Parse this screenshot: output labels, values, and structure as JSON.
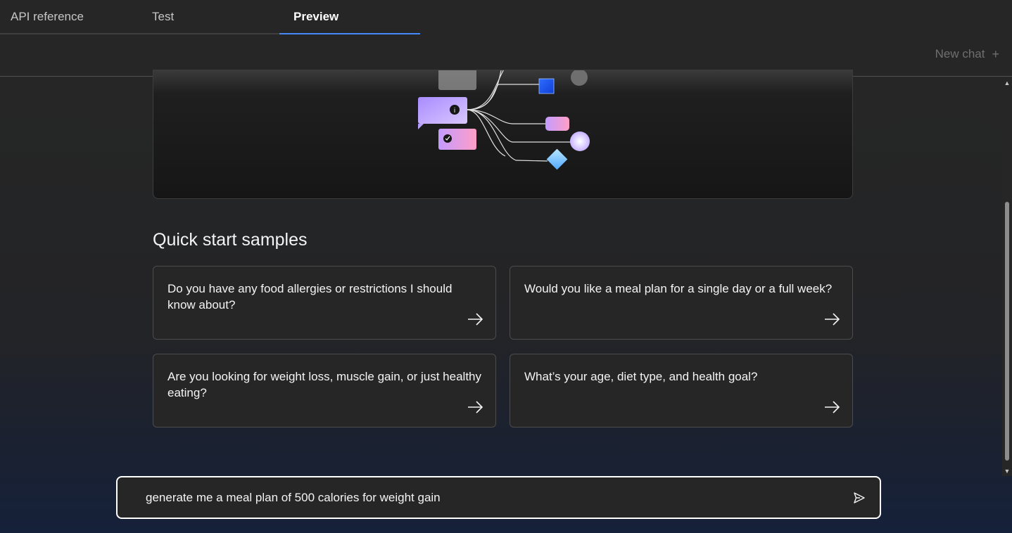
{
  "tabs": [
    {
      "label": "API reference",
      "active": false
    },
    {
      "label": "Test",
      "active": false
    },
    {
      "label": "Preview",
      "active": true
    }
  ],
  "toolbar": {
    "new_chat_label": "New chat",
    "new_chat_icon": "plus-icon"
  },
  "quick_start": {
    "title": "Quick start samples",
    "samples": [
      {
        "text": "Do you have any food allergies or restrictions I should know about?",
        "icon": "arrow-right-icon"
      },
      {
        "text": "Would you like a meal plan for a single day or a full week?",
        "icon": "arrow-right-icon"
      },
      {
        "text": "Are you looking for weight loss, muscle gain, or just healthy eating?",
        "icon": "arrow-right-icon"
      },
      {
        "text": "What’s your age, diet type, and health goal?",
        "icon": "arrow-right-icon"
      }
    ]
  },
  "chat": {
    "input_value": "generate me a meal plan of 500 calories for weight gain",
    "send_icon": "send-icon"
  },
  "colors": {
    "active_tab": "#4589ff",
    "background": "#262626",
    "card_border": "#4c4c4c"
  }
}
